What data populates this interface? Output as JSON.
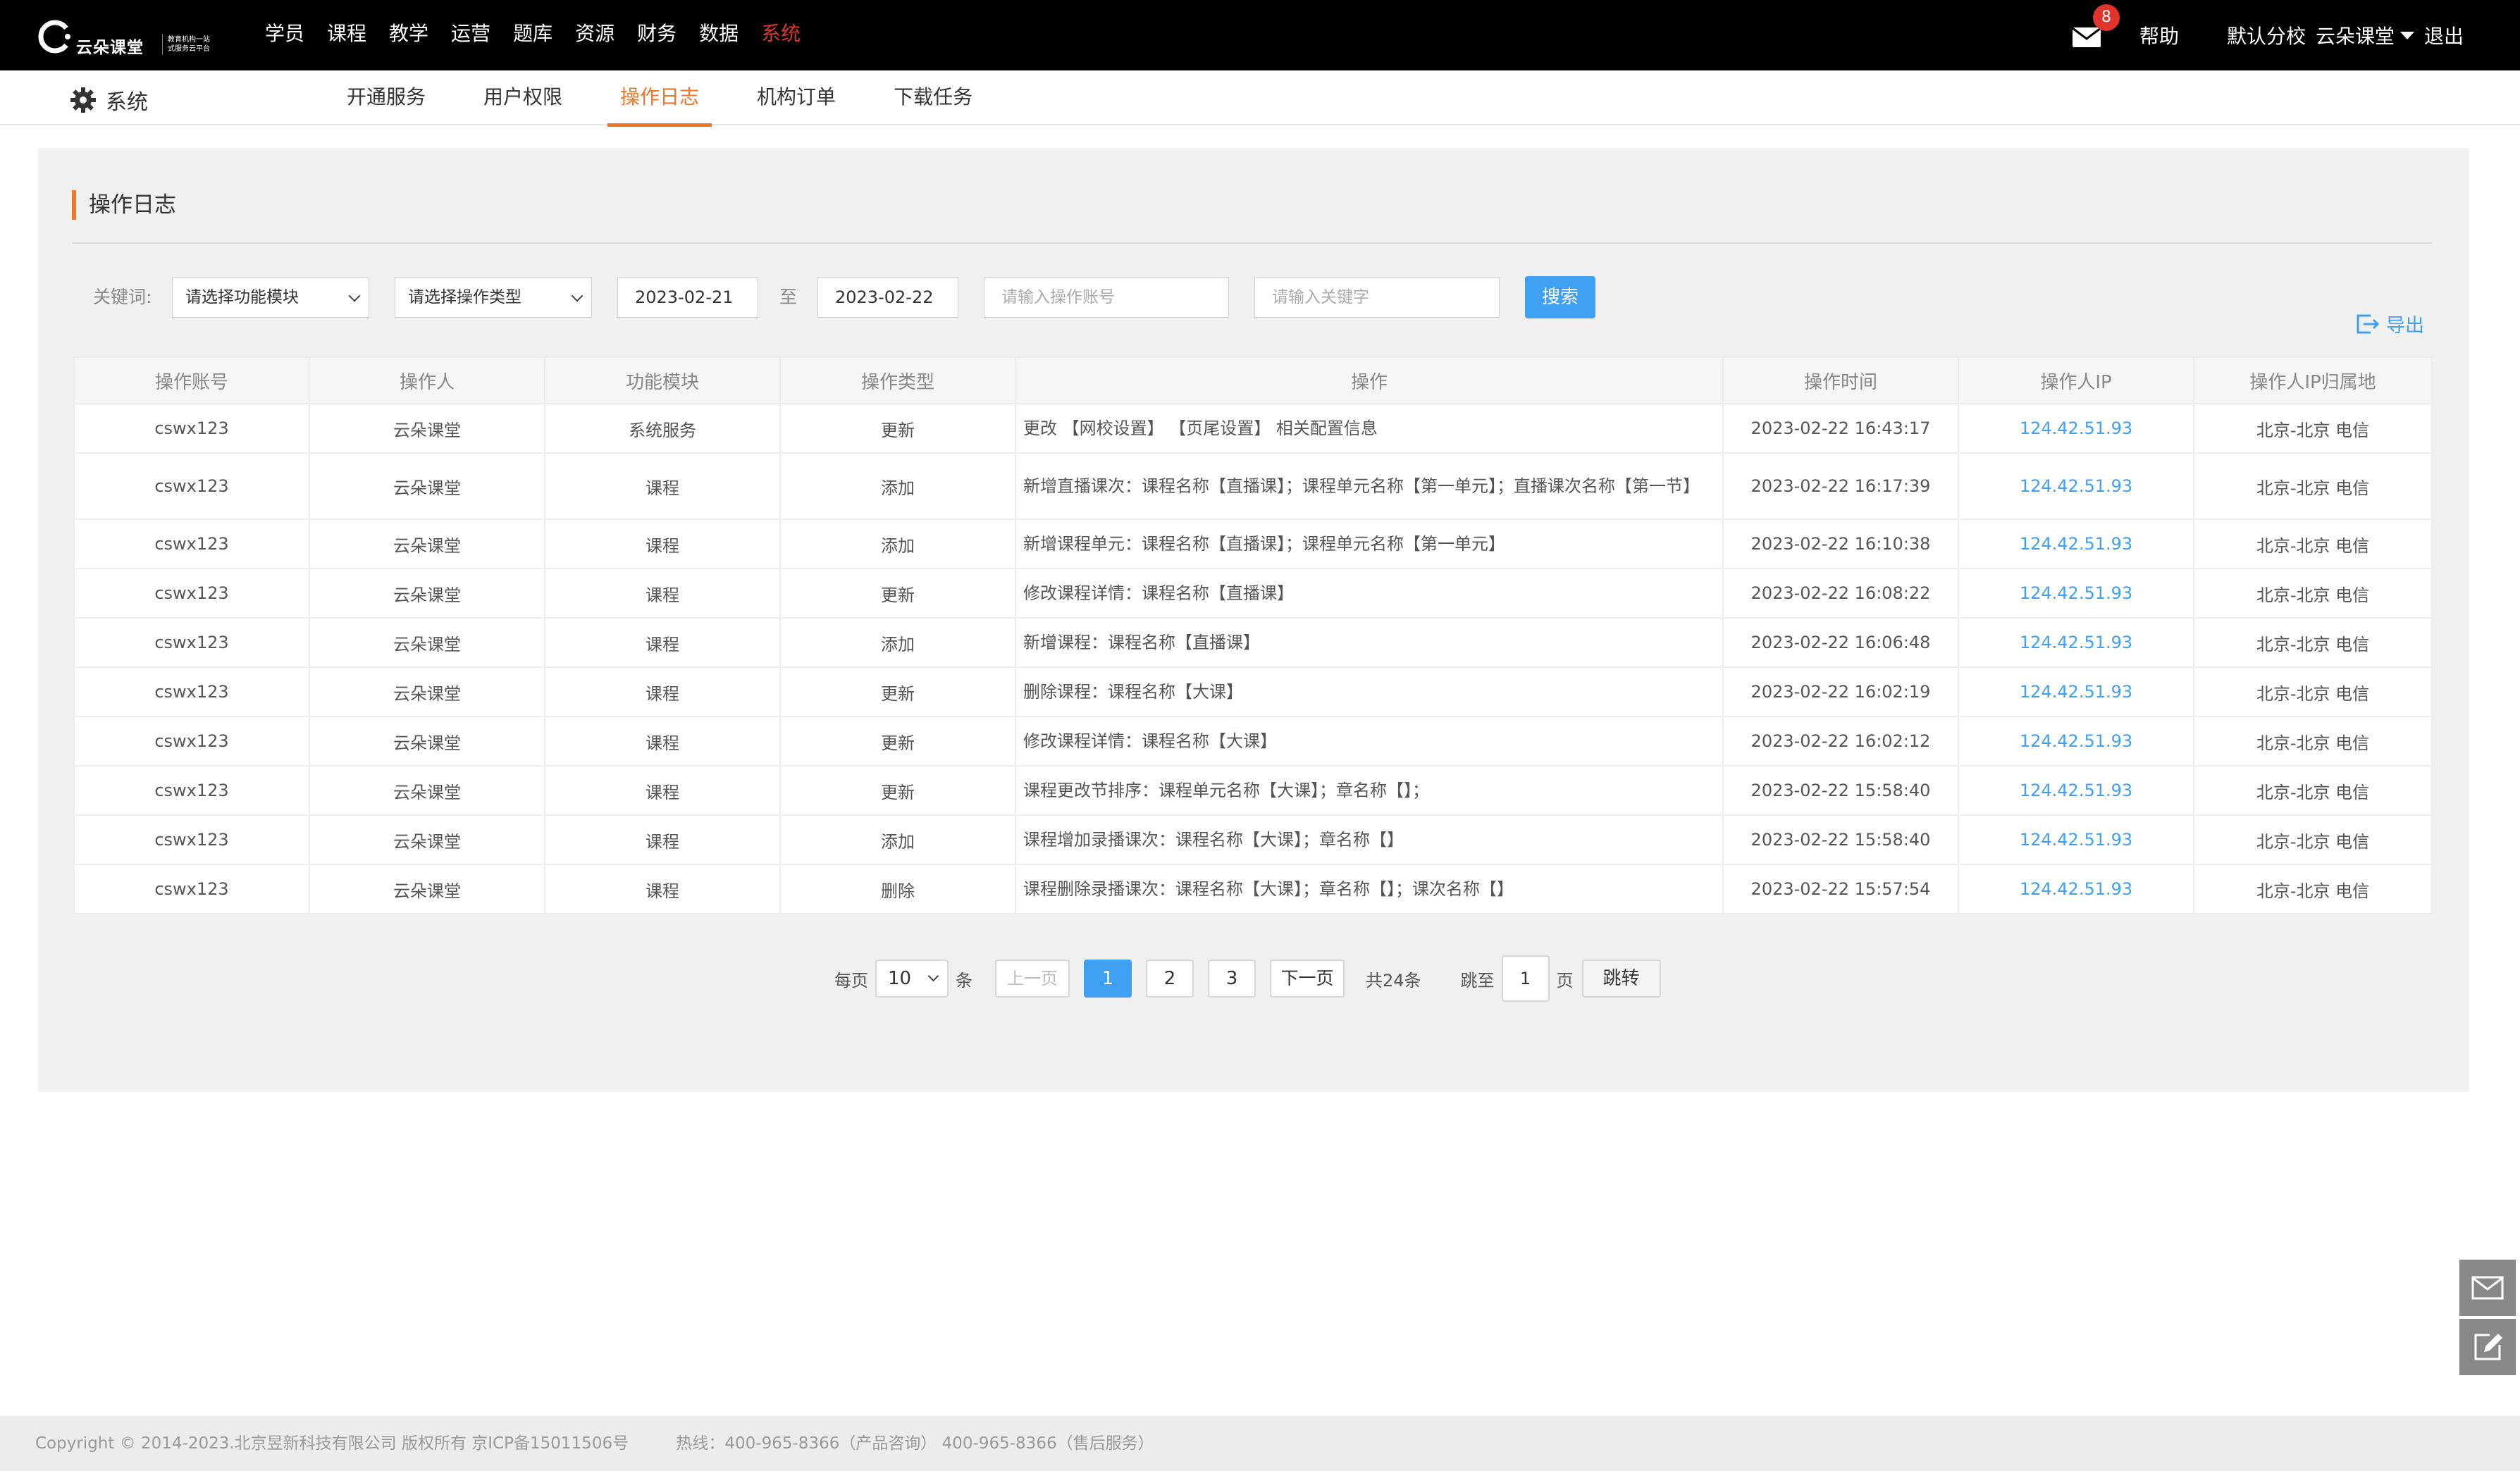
{
  "header": {
    "logo_text": "云朵课堂",
    "logo_sub1": "教育机构一站",
    "logo_sub2": "式服务云平台",
    "nav": [
      "学员",
      "课程",
      "教学",
      "运营",
      "题库",
      "资源",
      "财务",
      "数据",
      "系统"
    ],
    "active_nav": "系统",
    "mail_count": "8",
    "help": "帮助",
    "branch": "默认分校",
    "user": "云朵课堂",
    "logout": "退出"
  },
  "subheader": {
    "title": "系统",
    "tabs": [
      "开通服务",
      "用户权限",
      "操作日志",
      "机构订单",
      "下载任务"
    ],
    "active_tab": "操作日志"
  },
  "panel": {
    "title": "操作日志"
  },
  "filters": {
    "keyword_label": "关键词:",
    "module_select": "请选择功能模块",
    "type_select": "请选择操作类型",
    "date_from": "2023-02-21",
    "date_sep": "至",
    "date_to": "2023-02-22",
    "account_placeholder": "请输入操作账号",
    "keyword_placeholder": "请输入关键字",
    "search_label": "搜索",
    "export_label": "导出"
  },
  "table": {
    "columns": [
      "操作账号",
      "操作人",
      "功能模块",
      "操作类型",
      "操作",
      "操作时间",
      "操作人IP",
      "操作人IP归属地"
    ],
    "rows": [
      [
        "cswx123",
        "云朵课堂",
        "系统服务",
        "更新",
        "更改 【网校设置】 【页尾设置】 相关配置信息",
        "2023-02-22 16:43:17",
        "124.42.51.93",
        "北京-北京 电信"
      ],
      [
        "cswx123",
        "云朵课堂",
        "课程",
        "添加",
        "新增直播课次：课程名称【直播课】；课程单元名称【第一单元】；直播课次名称【第一节】",
        "2023-02-22 16:17:39",
        "124.42.51.93",
        "北京-北京 电信"
      ],
      [
        "cswx123",
        "云朵课堂",
        "课程",
        "添加",
        "新增课程单元：课程名称【直播课】；课程单元名称【第一单元】",
        "2023-02-22 16:10:38",
        "124.42.51.93",
        "北京-北京 电信"
      ],
      [
        "cswx123",
        "云朵课堂",
        "课程",
        "更新",
        "修改课程详情：课程名称【直播课】",
        "2023-02-22 16:08:22",
        "124.42.51.93",
        "北京-北京 电信"
      ],
      [
        "cswx123",
        "云朵课堂",
        "课程",
        "添加",
        "新增课程：课程名称【直播课】",
        "2023-02-22 16:06:48",
        "124.42.51.93",
        "北京-北京 电信"
      ],
      [
        "cswx123",
        "云朵课堂",
        "课程",
        "更新",
        "删除课程：课程名称【大课】",
        "2023-02-22 16:02:19",
        "124.42.51.93",
        "北京-北京 电信"
      ],
      [
        "cswx123",
        "云朵课堂",
        "课程",
        "更新",
        "修改课程详情：课程名称【大课】",
        "2023-02-22 16:02:12",
        "124.42.51.93",
        "北京-北京 电信"
      ],
      [
        "cswx123",
        "云朵课堂",
        "课程",
        "更新",
        "课程更改节排序：课程单元名称【大课】；章名称【】；",
        "2023-02-22 15:58:40",
        "124.42.51.93",
        "北京-北京 电信"
      ],
      [
        "cswx123",
        "云朵课堂",
        "课程",
        "添加",
        "课程增加录播课次：课程名称【大课】；章名称【】",
        "2023-02-22 15:58:40",
        "124.42.51.93",
        "北京-北京 电信"
      ],
      [
        "cswx123",
        "云朵课堂",
        "课程",
        "删除",
        "课程删除录播课次：课程名称【大课】；章名称【】；课次名称【】",
        "2023-02-22 15:57:54",
        "124.42.51.93",
        "北京-北京 电信"
      ]
    ]
  },
  "pager": {
    "per_page_label": "每页",
    "per_page_value": "10",
    "per_page_unit": "条",
    "prev": "上一页",
    "pages": [
      "1",
      "2",
      "3"
    ],
    "current_page": "1",
    "next": "下一页",
    "total": "共24条",
    "jump_label": "跳至",
    "jump_value": "1",
    "jump_unit": "页",
    "jump_button": "跳转"
  },
  "footer": {
    "copyright": "Copyright © 2014-2023.北京昱新科技有限公司 版权所有 京ICP备15011506号",
    "hotline": "热线：400-965-8366（产品咨询） 400-965-8366（售后服务）"
  },
  "colors": {
    "accent_orange": "#f0772a",
    "accent_blue": "#3f9ff0",
    "active_red": "#e0342d"
  },
  "icons": [
    "cloud-logo-icon",
    "mail-icon",
    "gear-icon",
    "export-icon",
    "float-mail-icon",
    "float-edit-icon"
  ]
}
